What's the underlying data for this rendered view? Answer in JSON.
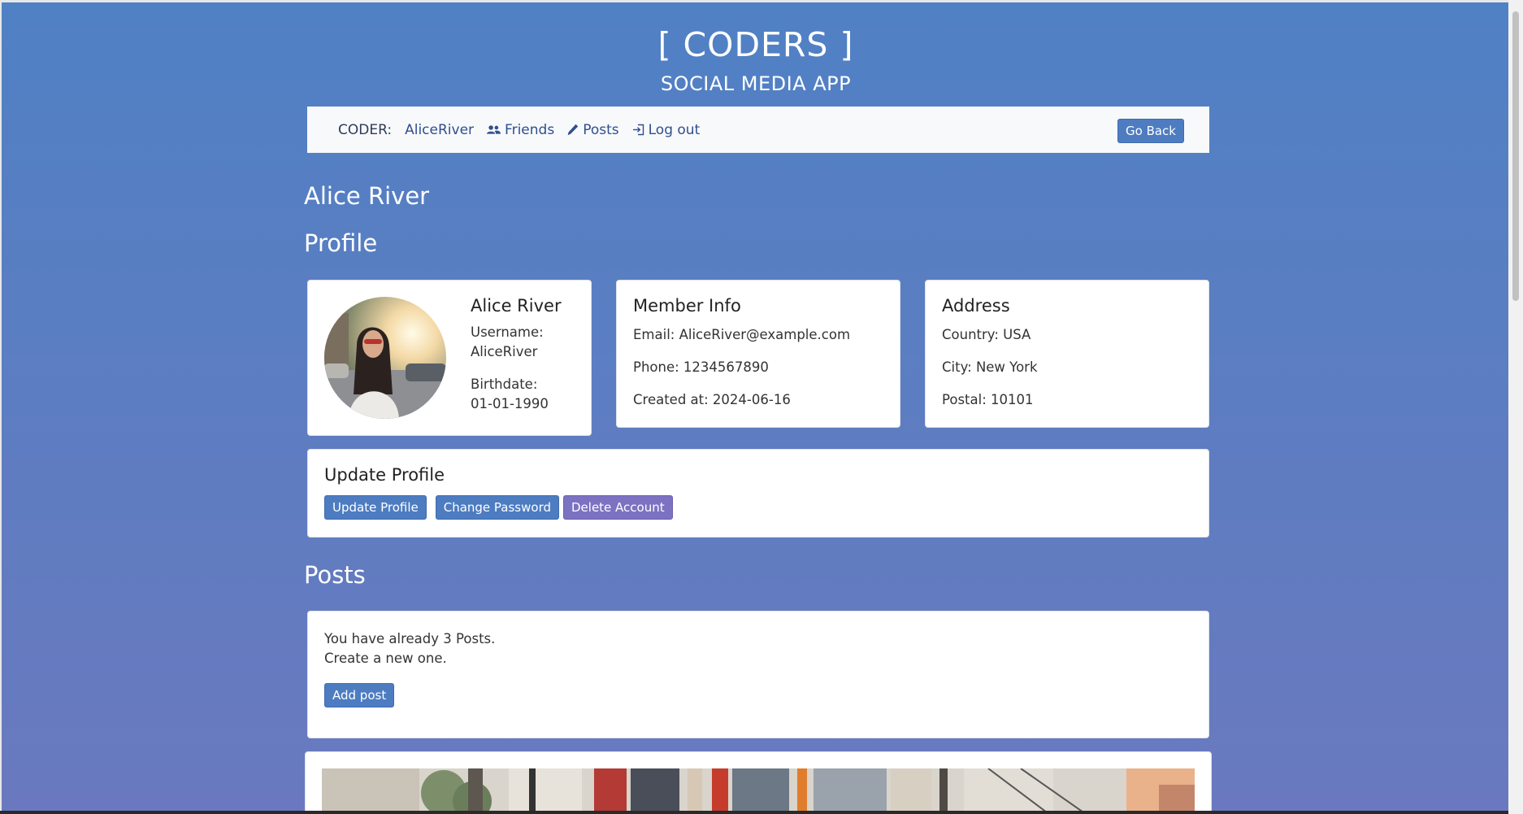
{
  "header": {
    "title": "[ CODERS ]",
    "subtitle": "SOCIAL MEDIA APP"
  },
  "nav": {
    "coder_label": "CODER:",
    "username": "AliceRiver",
    "friends": "Friends",
    "posts": "Posts",
    "logout": "Log out",
    "go_back": "Go Back"
  },
  "page": {
    "user_name": "Alice River",
    "profile_heading": "Profile",
    "posts_heading": "Posts"
  },
  "profile_card": {
    "name": "Alice River",
    "username_label": "Username:",
    "username_value": "AliceRiver",
    "birthdate_label": "Birthdate:",
    "birthdate_value": "01-01-1990"
  },
  "member_info": {
    "title": "Member Info",
    "email": "Email: AliceRiver@example.com",
    "phone": "Phone: 1234567890",
    "created": "Created at: 2024-06-16"
  },
  "address": {
    "title": "Address",
    "country": "Country: USA",
    "city": "City: New York",
    "postal": "Postal: 10101"
  },
  "update_profile": {
    "title": "Update Profile",
    "update_button": "Update Profile",
    "password_button": "Change Password",
    "delete_button": "Delete Account"
  },
  "posts_card": {
    "line1": "You have already 3 Posts.",
    "line2": "Create a new one.",
    "add_button": "Add post"
  }
}
